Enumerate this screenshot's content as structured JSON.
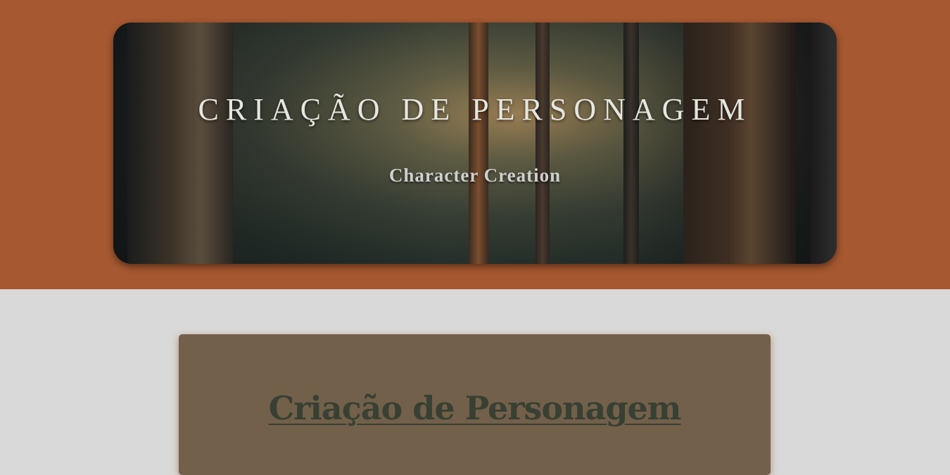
{
  "header": {
    "title": "CRIAÇÃO DE PERSONAGEM",
    "subtitle": "Character Creation",
    "background_image": "forest-trees"
  },
  "main": {
    "card_title": "Criação de Personagem"
  },
  "colors": {
    "top_band": "#a65830",
    "page_background": "#d9d9d9",
    "card_background": "#72604a",
    "card_title": "#384033",
    "banner_text": "#e6e6e0"
  }
}
